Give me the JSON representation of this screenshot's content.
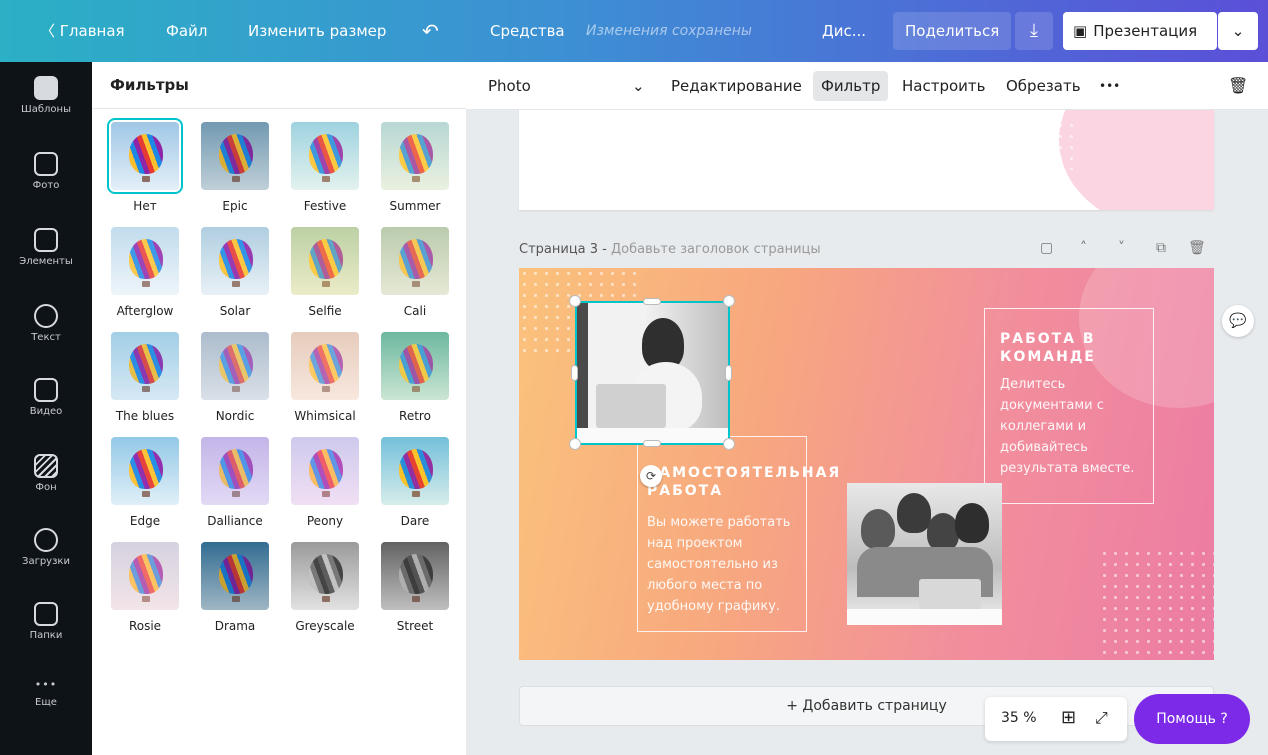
{
  "topbar": {
    "back_label": "〈 Главная",
    "file_label": "Файл",
    "resize_label": "Изменить размер",
    "undo_icon": "↶",
    "tools_label": "Средства",
    "save_status": "Изменения сохранены",
    "design_title": "Дис...",
    "share_label": "Поделиться",
    "download_icon": "⤓",
    "present_icon": "▣",
    "present_label": "Презентация",
    "present_dropdown_icon": "⌄"
  },
  "rail": {
    "items": [
      {
        "label": "Шаблоны",
        "icon": "templates-icon"
      },
      {
        "label": "Фото",
        "icon": "photo-icon"
      },
      {
        "label": "Элементы",
        "icon": "elements-icon"
      },
      {
        "label": "Текст",
        "icon": "text-icon"
      },
      {
        "label": "Видео",
        "icon": "video-icon"
      },
      {
        "label": "Фон",
        "icon": "background-icon"
      },
      {
        "label": "Загрузки",
        "icon": "uploads-icon"
      },
      {
        "label": "Папки",
        "icon": "folders-icon"
      },
      {
        "label": "Еще",
        "icon": "more-icon"
      }
    ],
    "more_dots": "•••"
  },
  "panel": {
    "title": "Фильтры",
    "filters": [
      {
        "label": "Нет",
        "bg": "#9fc7e6",
        "tint": "rgba(0,0,0,0)",
        "selected": true
      },
      {
        "label": "Epic",
        "bg": "#7fa7bf",
        "tint": "rgba(40,80,100,0.15)",
        "selected": false
      },
      {
        "label": "Festive",
        "bg": "#8ecbe8",
        "tint": "rgba(255,255,180,0.15)",
        "selected": false
      },
      {
        "label": "Summer",
        "bg": "#9fd0e8",
        "tint": "rgba(255,240,150,0.25)",
        "selected": false
      },
      {
        "label": "Afterglow",
        "bg": "#b7d6ea",
        "tint": "rgba(255,255,255,0.15)",
        "selected": false
      },
      {
        "label": "Solar",
        "bg": "#a7c9de",
        "tint": "rgba(255,255,255,0.1)",
        "selected": false
      },
      {
        "label": "Selfie",
        "bg": "#9fc8b8",
        "tint": "rgba(255,230,120,0.3)",
        "selected": false
      },
      {
        "label": "Cali",
        "bg": "#a9c5b0",
        "tint": "rgba(230,220,170,0.3)",
        "selected": false
      },
      {
        "label": "The blues",
        "bg": "#a9d3e8",
        "tint": "rgba(120,180,220,0.15)",
        "selected": false
      },
      {
        "label": "Nordic",
        "bg": "#9db1c4",
        "tint": "rgba(200,210,220,0.35)",
        "selected": false
      },
      {
        "label": "Whimsical",
        "bg": "#d9c3b6",
        "tint": "rgba(255,220,200,0.35)",
        "selected": false
      },
      {
        "label": "Retro",
        "bg": "#4fa8a0",
        "tint": "rgba(200,230,160,0.25)",
        "selected": false
      },
      {
        "label": "Edge",
        "bg": "#8ec6e6",
        "tint": "rgba(255,255,255,0.05)",
        "selected": false
      },
      {
        "label": "Dalliance",
        "bg": "#c3b6e6",
        "tint": "rgba(200,180,240,0.3)",
        "selected": false
      },
      {
        "label": "Peony",
        "bg": "#b9d4f0",
        "tint": "rgba(255,180,230,0.3)",
        "selected": false
      },
      {
        "label": "Dare",
        "bg": "#6dbde6",
        "tint": "rgba(255,255,0,0.05)",
        "selected": false
      },
      {
        "label": "Rosie",
        "bg": "#bfd7ec",
        "tint": "rgba(255,200,200,0.35)",
        "selected": false
      },
      {
        "label": "Drama",
        "bg": "#3f7ea8",
        "tint": "rgba(0,40,60,0.2)",
        "selected": false
      },
      {
        "label": "Greyscale",
        "bg": "#9a9a9a",
        "tint": "rgba(0,0,0,0)",
        "selected": false,
        "grey": true
      },
      {
        "label": "Street",
        "bg": "#6e6e6e",
        "tint": "rgba(0,0,0,0.1)",
        "selected": false,
        "grey": true
      }
    ]
  },
  "editbar": {
    "photo_label": "Photo",
    "photo_dropdown_icon": "⌄",
    "edit_label": "Редактирование",
    "filter_label": "Фильтр",
    "adjust_label": "Настроить",
    "crop_label": "Обрезать",
    "more_icon": "•••",
    "delete_icon": "🗑"
  },
  "canvas": {
    "page3_label": "Страница 3 -",
    "page3_placeholder": "Добавьте заголовок страницы",
    "page_icons": {
      "note": "▢",
      "up": "˄",
      "down": "˅",
      "copy": "⧉",
      "delete": "🗑"
    },
    "card_left_title": "САМОСТОЯТЕЛЬНАЯ РАБОТА",
    "card_left_text": "Вы можете работать над проектом самостоятельно из любого места по удобному графику.",
    "card_right_title": "РАБОТА В КОМАНДЕ",
    "card_right_text": "Делитесь документами с коллегами и добивайтесь результата вместе.",
    "rotate_icon": "⟳",
    "comment_icon": "💬",
    "add_page_label": "+ Добавить страницу"
  },
  "zoom": {
    "value": "35 %",
    "grid_icon": "⊞",
    "fullscreen_icon": "⤢"
  },
  "help": {
    "label": "Помощь ?"
  },
  "colors": {
    "accent_teal": "#00c4cc",
    "help_purple": "#7d2ae8"
  }
}
